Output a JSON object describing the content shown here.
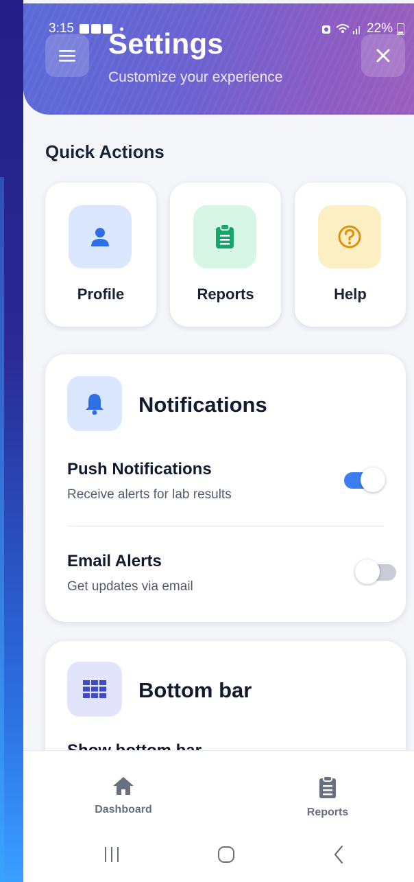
{
  "status_bar": {
    "time": "3:15",
    "battery": "22%"
  },
  "header": {
    "title": "Settings",
    "subtitle": "Customize your experience"
  },
  "quick_actions": {
    "title": "Quick Actions",
    "items": [
      {
        "label": "Profile",
        "icon": "person-icon",
        "color": "#2f6fe6",
        "bg": "#dbe7ff"
      },
      {
        "label": "Reports",
        "icon": "clipboard-icon",
        "color": "#14a66a",
        "bg": "#d7f6e6"
      },
      {
        "label": "Help",
        "icon": "question-circle-icon",
        "color": "#e0900c",
        "bg": "#fdefc4"
      }
    ]
  },
  "notifications": {
    "title": "Notifications",
    "icon": "bell-icon",
    "rows": [
      {
        "title": "Push Notifications",
        "subtitle": "Receive alerts for lab results",
        "enabled": true
      },
      {
        "title": "Email Alerts",
        "subtitle": "Get updates via email",
        "enabled": false
      }
    ]
  },
  "bottom_bar_settings": {
    "title": "Bottom bar",
    "icon": "grid-icon",
    "first_row_title": "Show bottom bar"
  },
  "bottom_nav": {
    "items": [
      {
        "label": "Dashboard",
        "icon": "home-icon"
      },
      {
        "label": "Reports",
        "icon": "clipboard-icon"
      }
    ]
  },
  "colors": {
    "accent": "#3b7ef0",
    "header_gradient_start": "#5a6ad8",
    "header_gradient_end": "#9a5ebd",
    "text_primary": "#121a2e"
  }
}
